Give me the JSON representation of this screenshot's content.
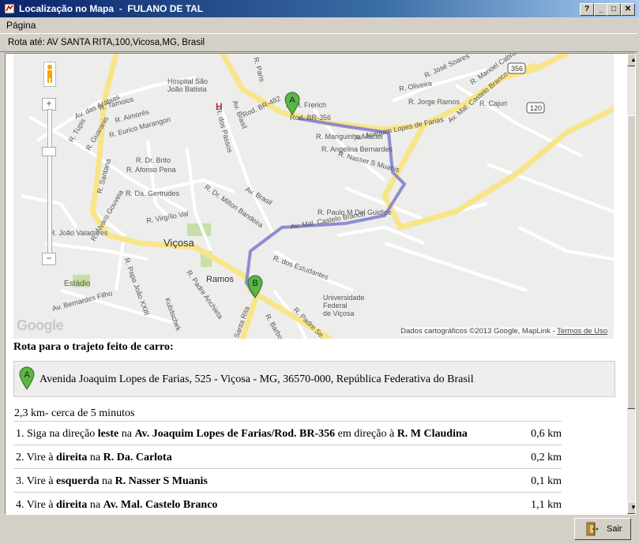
{
  "window": {
    "title": "Localização no Mapa  -  FULANO DE TAL",
    "help_glyph": "?",
    "minimize_glyph": "_",
    "maximize_glyph": "□",
    "close_glyph": "✕"
  },
  "menu": {
    "items": [
      "Página"
    ]
  },
  "route_bar": {
    "label": "Rota até: AV  SANTA RITA,100,Vicosa,MG, Brasil"
  },
  "map": {
    "attribution": "Dados cartográficos ©2013 Google, MapLink - ",
    "terms_link": "Termos de Uso",
    "logo_text": "Google",
    "zoom_in": "+",
    "zoom_out": "−",
    "marker_a": "A",
    "marker_b": "B",
    "hospital_symbol": "H",
    "labels": {
      "hospital": "Hospital São\nJoão Batista",
      "vicosa": "Viçosa",
      "ramos": "Ramos",
      "estadio": "Estádio",
      "universidade": "Universidade\nFederal\nde Viçosa",
      "rod_br356": "Rod. BR-356",
      "rod_br482": "Rod. BR-482",
      "av_joaquim": "Av. Joaquim Lopes de Farias",
      "av_castelo": "Av. Mal. Castelo Branco",
      "av_castelo_top": "Av. Mal. Castelo Branco",
      "r_alvaro": "R. Álvaro Gouveia",
      "r_eurico": "R. Eurico Marangon",
      "av_arabias": "Av. das Arábias",
      "r_tamoios": "R. Tamoios",
      "r_aimores": "R. Aimorés",
      "r_tupis": "R. Tupis",
      "r_guaranis": "R. Guaranis",
      "r_santana": "R. Santana",
      "r_brito": "R. Dr. Brito",
      "r_afonso": "R. Afonso Pena",
      "r_gertrudes": "R. Da. Gertrudes",
      "r_milton": "R. Dr. Milton Bandeira",
      "r_virgilio": "R. Virgílio Val",
      "av_brasil": "Av. Brasil",
      "av_brasil2": "Av. Brasil",
      "r_passos": "R. dos Passos",
      "r_paris": "R. Paris",
      "r_marigu": "R. Mariguinha Maciel",
      "r_angelina": "R. Angelina Bernardes",
      "r_nasser": "R. Nasser S Muanis",
      "r_paulo": "R. Paulo M Del Guidice",
      "r_estudantes": "R. dos Estudantes",
      "r_jorge": "R. Jorge Ramos",
      "r_oliveira": "R. Oliveira",
      "r_jose": "R. José Soares",
      "r_manoel": "R. Manoel Cabral",
      "r_cajuri": "R. Cajuri",
      "r_joao_val": "R. João Valadares",
      "av_bernardes": "Av. Bernardes Filho",
      "r_papa": "R. Papa João XXIII",
      "r_padre_anch": "R. Padre Anchieta",
      "r_padre_se": "R. Padre Se...",
      "r_barbosa": "R. Barbosa",
      "r_santa_rita": "Santa Rita",
      "r_ubitschek": "Kubitschek",
      "r_hermen": "R. H. Frerich",
      "shield_356": "356",
      "shield_120": "120"
    }
  },
  "directions": {
    "heading": "Rota para o trajeto feito de carro:",
    "origin_marker": "A",
    "origin_address": "Avenida Joaquim Lopes de Farias, 525 - Viçosa - MG, 36570-000, República Federativa do Brasil",
    "summary": "2,3 km- cerca de 5 minutos",
    "steps": [
      {
        "number": "1.",
        "text": "Siga na direção ",
        "bold1": "leste",
        "mid1": " na ",
        "bold2": "Av. Joaquim Lopes de Farias/Rod. BR-356",
        "mid2": " em direção à ",
        "bold3": "R. M Claudina",
        "distance": "0,6 km"
      },
      {
        "number": "2.",
        "text": "Vire à ",
        "bold1": "direita",
        "mid1": " na ",
        "bold2": "R. Da. Carlota",
        "mid2": "",
        "bold3": "",
        "distance": "0,2 km"
      },
      {
        "number": "3.",
        "text": "Vire à ",
        "bold1": "esquerda",
        "mid1": " na ",
        "bold2": "R. Nasser S Muanis",
        "mid2": "",
        "bold3": "",
        "distance": "0,1 km"
      },
      {
        "number": "4.",
        "text": "Vire à ",
        "bold1": "direita",
        "mid1": " na ",
        "bold2": "Av. Mal. Castelo Branco",
        "mid2": "",
        "bold3": "",
        "distance": "1,1 km"
      }
    ]
  },
  "footer": {
    "exit_label": "Sair"
  },
  "colors": {
    "route": "#7b7bd0",
    "main_road": "#f8e58a",
    "road": "#ffffff",
    "map_bg": "#ededeb",
    "park": "#c8dfa8"
  }
}
